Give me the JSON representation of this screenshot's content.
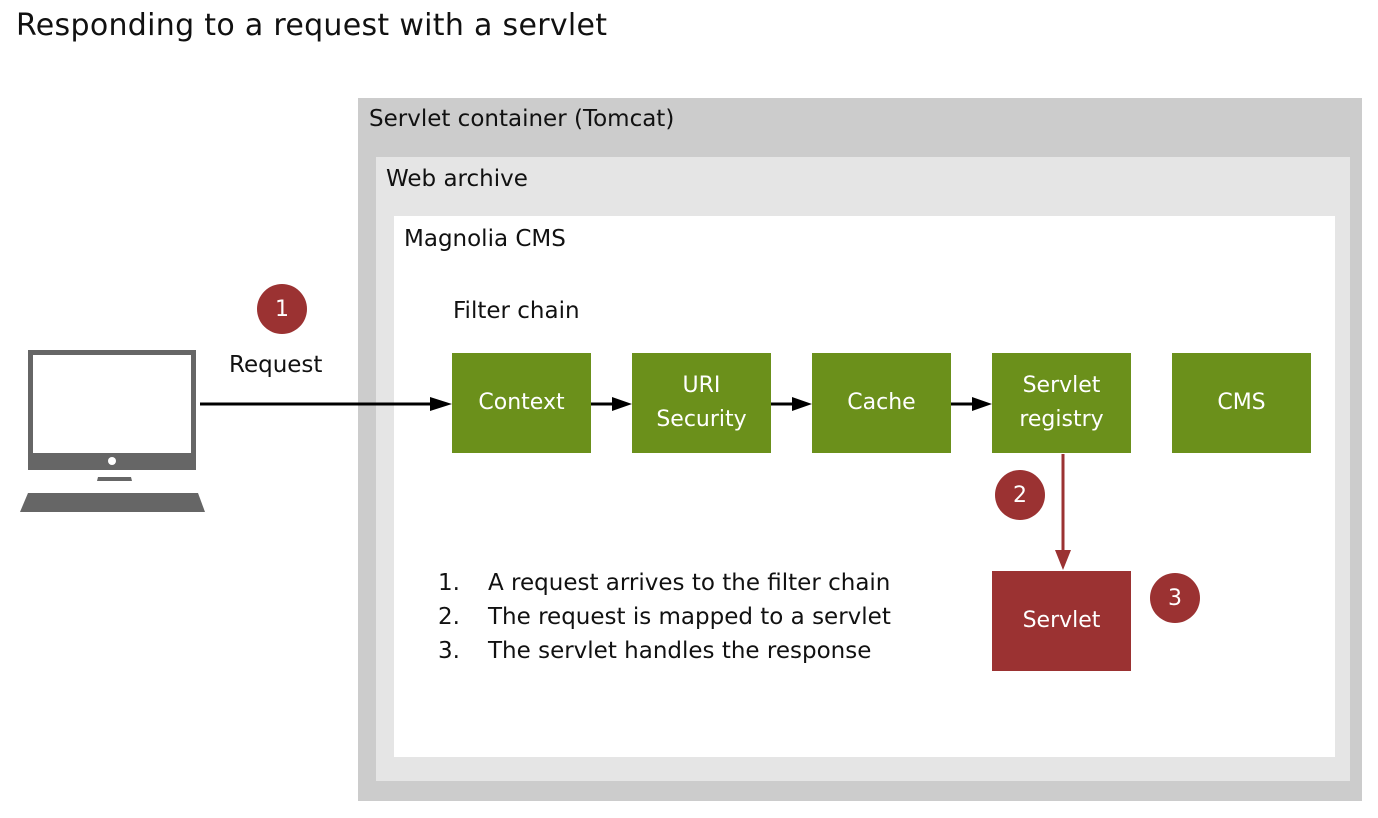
{
  "title": "Responding to a request with a servlet",
  "containers": {
    "servlet_container": "Servlet container (Tomcat)",
    "web_archive": "Web archive",
    "magnolia": "Magnolia CMS"
  },
  "filter_chain_label": "Filter chain",
  "request_label": "Request",
  "filters": [
    {
      "label": "Context"
    },
    {
      "label": "URI\nSecurity"
    },
    {
      "label": "Cache"
    },
    {
      "label": "Servlet\nregistry"
    },
    {
      "label": "CMS"
    }
  ],
  "servlet_box": "Servlet",
  "badges": [
    "1",
    "2",
    "3"
  ],
  "steps": [
    {
      "num": "1.",
      "text": "A request arrives to the filter chain"
    },
    {
      "num": "2.",
      "text": "The request is mapped to a servlet"
    },
    {
      "num": "3.",
      "text": "The servlet handles the response"
    }
  ],
  "colors": {
    "filter_green": "#6b901b",
    "servlet_red": "#9b3232",
    "outer_gray": "#cccccc",
    "archive_gray": "#e5e5e5",
    "computer_gray": "#666666"
  }
}
